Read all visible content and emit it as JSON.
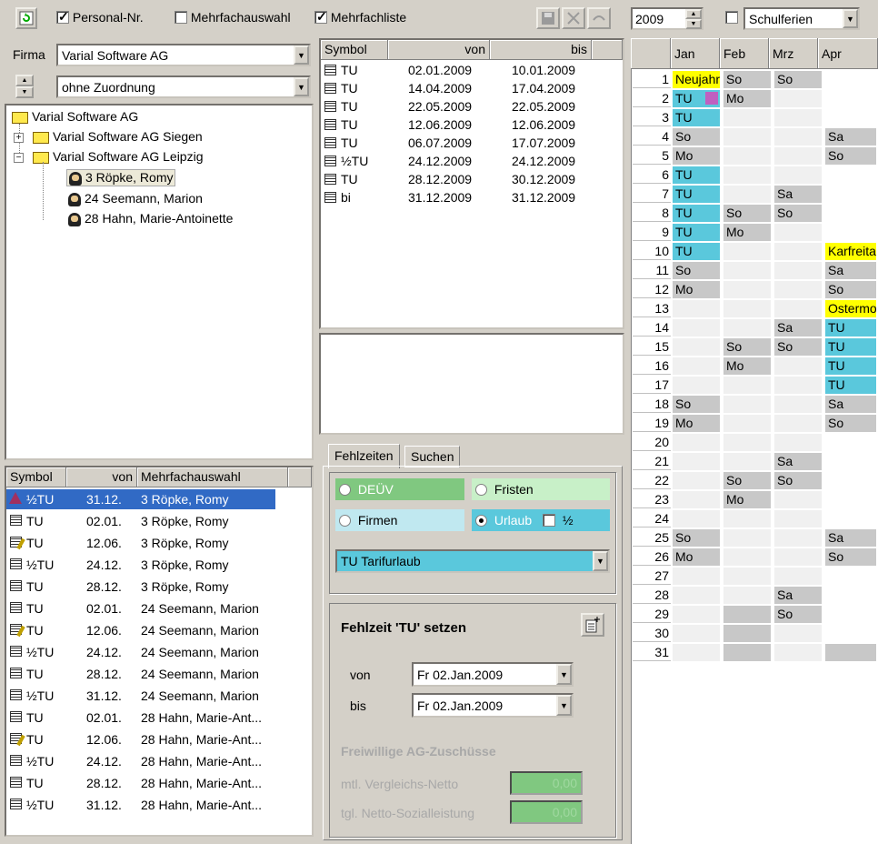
{
  "toolbar": {
    "personal_nr_label": "Personal-Nr.",
    "mehrfachauswahl_label": "Mehrfachauswahl",
    "mehrfachliste_label": "Mehrfachliste",
    "year_value": "2009",
    "schulferien_label": "Schulferien"
  },
  "firma": {
    "label": "Firma",
    "value": "Varial Software AG",
    "zuordnung": "ohne Zuordnung"
  },
  "tree": {
    "root": "Varial Software AG",
    "siegen": "Varial Software AG Siegen",
    "leipzig": "Varial Software AG Leipzig",
    "p1": "3 Röpke, Romy",
    "p2": "24 Seemann, Marion",
    "p3": "28 Hahn, Marie-Antoinette"
  },
  "symbols_table": {
    "headers": [
      "Symbol",
      "von",
      "bis"
    ],
    "rows": [
      [
        "TU",
        "02.01.2009",
        "10.01.2009"
      ],
      [
        "TU",
        "14.04.2009",
        "17.04.2009"
      ],
      [
        "TU",
        "22.05.2009",
        "22.05.2009"
      ],
      [
        "TU",
        "12.06.2009",
        "12.06.2009"
      ],
      [
        "TU",
        "06.07.2009",
        "17.07.2009"
      ],
      [
        "½TU",
        "24.12.2009",
        "24.12.2009"
      ],
      [
        "TU",
        "28.12.2009",
        "30.12.2009"
      ],
      [
        "bi",
        "31.12.2009",
        "31.12.2009"
      ]
    ]
  },
  "multi_table": {
    "headers": [
      "Symbol",
      "von",
      "Mehrfachauswahl"
    ],
    "rows": [
      [
        "½TU",
        "31.12.",
        "3 Röpke, Romy"
      ],
      [
        "TU",
        "02.01.",
        "3 Röpke, Romy"
      ],
      [
        "TU",
        "12.06.",
        "3 Röpke, Romy"
      ],
      [
        "½TU",
        "24.12.",
        "3 Röpke, Romy"
      ],
      [
        "TU",
        "28.12.",
        "3 Röpke, Romy"
      ],
      [
        "TU",
        "02.01.",
        "24 Seemann, Marion"
      ],
      [
        "TU",
        "12.06.",
        "24 Seemann, Marion"
      ],
      [
        "½TU",
        "24.12.",
        "24 Seemann, Marion"
      ],
      [
        "TU",
        "28.12.",
        "24 Seemann, Marion"
      ],
      [
        "½TU",
        "31.12.",
        "24 Seemann, Marion"
      ],
      [
        "TU",
        "02.01.",
        "28 Hahn, Marie-Ant..."
      ],
      [
        "TU",
        "12.06.",
        "28 Hahn, Marie-Ant..."
      ],
      [
        "½TU",
        "24.12.",
        "28 Hahn, Marie-Ant..."
      ],
      [
        "TU",
        "28.12.",
        "28 Hahn, Marie-Ant..."
      ],
      [
        "½TU",
        "31.12.",
        "28 Hahn, Marie-Ant..."
      ]
    ]
  },
  "tabs": {
    "fehlzeiten": "Fehlzeiten",
    "suchen": "Suchen"
  },
  "options": {
    "deuev": "DEÜV",
    "fristen": "Fristen",
    "firmen": "Firmen",
    "urlaub": "Urlaub",
    "half": "½",
    "type_select": "TU Tarifurlaub"
  },
  "set_panel": {
    "title": "Fehlzeit 'TU' setzen",
    "von_label": "von",
    "von_value": "Fr  02.Jan.2009",
    "bis_label": "bis",
    "bis_value": "Fr  02.Jan.2009",
    "zuschuss_title": "Freiwillige AG-Zuschüsse",
    "vergleich_label": "mtl. Vergleichs-Netto",
    "vergleich_value": "0,00",
    "netto_label": "tgl. Netto-Sozialleistung",
    "netto_value": "0,00"
  },
  "calendar": {
    "months": [
      "Jan",
      "Feb",
      "Mrz",
      "Apr"
    ],
    "days": [
      "1",
      "2",
      "3",
      "4",
      "5",
      "6",
      "7",
      "8",
      "9",
      "10",
      "11",
      "12",
      "13",
      "14",
      "15",
      "16",
      "17",
      "18",
      "19",
      "20",
      "21",
      "22",
      "23",
      "24",
      "25",
      "26",
      "27",
      "28",
      "29",
      "30",
      "31"
    ],
    "jan": [
      "Neujahr",
      "TU",
      "TU",
      "So",
      "Mo",
      "TU",
      "TU",
      "TU",
      "TU",
      "TU",
      "So",
      "Mo",
      "",
      "",
      "",
      "",
      "",
      "So",
      "Mo",
      "",
      "",
      "",
      "",
      "",
      "So",
      "Mo",
      "",
      "",
      "",
      "",
      ""
    ],
    "feb": [
      "So",
      "Mo",
      "",
      "",
      "",
      "",
      "",
      "So",
      "Mo",
      "",
      "",
      "",
      "",
      "",
      "So",
      "Mo",
      "",
      "",
      "",
      "",
      "",
      "So",
      "Mo",
      "",
      "",
      "",
      "",
      "",
      "",
      "",
      ""
    ],
    "mrz": [
      "So",
      "",
      "",
      "",
      "",
      "",
      "Sa",
      "So",
      "",
      "",
      "",
      "",
      "",
      "Sa",
      "So",
      "",
      "",
      "",
      "",
      "",
      "Sa",
      "So",
      "",
      "",
      "",
      "",
      "",
      "Sa",
      "So",
      "",
      ""
    ],
    "apr": [
      "",
      "",
      "",
      "Sa",
      "So",
      "",
      "",
      "",
      "",
      "Karfreitag",
      "Sa",
      "So",
      "Ostermontag",
      "TU",
      "TU",
      "TU",
      "TU",
      "Sa",
      "So",
      "",
      "",
      "",
      "",
      "",
      "Sa",
      "So",
      "",
      "",
      "",
      "",
      ""
    ],
    "colors": {
      "holiday": "#ffff00",
      "tu": "#5ac8dc",
      "weekend": "#c8c8c8",
      "empty": "#f0f0f0",
      "selection": "#316ac5"
    }
  }
}
